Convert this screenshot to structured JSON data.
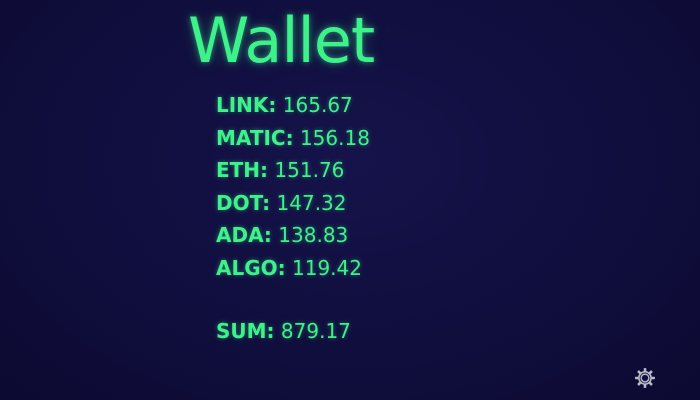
{
  "title": "Wallet",
  "holdings": [
    {
      "symbol": "LINK:",
      "value": "165.67"
    },
    {
      "symbol": "MATIC:",
      "value": "156.18"
    },
    {
      "symbol": "ETH:",
      "value": "151.76"
    },
    {
      "symbol": "DOT:",
      "value": "147.32"
    },
    {
      "symbol": "ADA:",
      "value": "138.83"
    },
    {
      "symbol": "ALGO:",
      "value": "119.42"
    }
  ],
  "sum": {
    "label": "SUM:",
    "value": "879.17"
  },
  "settings": {
    "icon": "gear-icon"
  },
  "colors": {
    "background": "#100e3d",
    "accent": "#3df28a",
    "icon": "#b8bcc8"
  }
}
